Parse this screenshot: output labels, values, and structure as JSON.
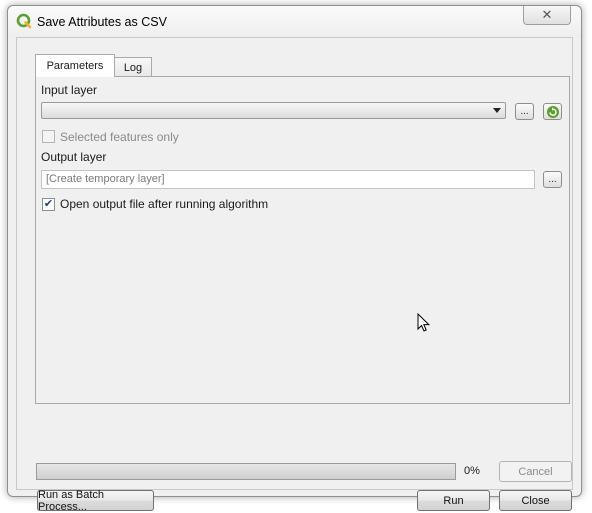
{
  "window": {
    "title": "Save Attributes as CSV",
    "close_glyph": "✕"
  },
  "tabs": [
    {
      "label": "Parameters",
      "active": true
    },
    {
      "label": "Log",
      "active": false
    }
  ],
  "params": {
    "input_layer_label": "Input layer",
    "input_layer_value": "",
    "browse_label": "...",
    "selected_only_label": "Selected features only",
    "selected_only_checked": false,
    "output_layer_label": "Output layer",
    "output_placeholder": "[Create temporary layer]",
    "open_output_label": "Open output file after running algorithm",
    "open_output_checked": true,
    "check_glyph": "✔"
  },
  "progress": {
    "value": 0,
    "text": "0%"
  },
  "buttons": {
    "cancel": "Cancel",
    "batch": "Run as Batch Process...",
    "run": "Run",
    "close": "Close"
  },
  "icons": {
    "app": "qgis-logo-icon",
    "refresh": "iterate-refresh-icon",
    "cursor": "mouse-pointer-icon"
  },
  "colors": {
    "qgis_green": "#5aa02c",
    "check_color": "#1f3f7a"
  }
}
